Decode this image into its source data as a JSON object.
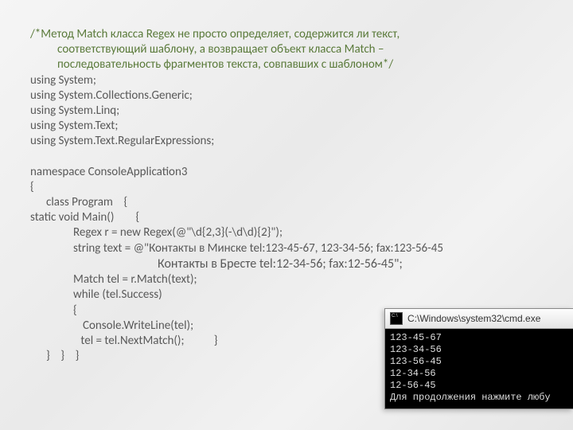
{
  "comment": {
    "line1": "/*Метод Match класса Regex не просто определяет, содержится ли текст,",
    "line2": "соответствующий шаблону, а возвращает объект класса Match –",
    "line3": "последовательность фрагментов текста, совпавших с шаблоном*/"
  },
  "code": {
    "l1": "using System;",
    "l2": "using System.Collections.Generic;",
    "l3": "using System.Linq;",
    "l4": "using System.Text;",
    "l5": "using System.Text.RegularExpressions;",
    "blank1": " ",
    "l6": "namespace ConsoleApplication3",
    "l7": "{",
    "l8": "class Program    {",
    "l9": "static void Main()        {",
    "l10": "Regex r = new Regex(@\"\\d{2,3}(-\\d\\d){2}\");",
    "l11": "string text = @\"Контакты в Минске tel:123-45-67, 123-34-56; fax:123-56-45",
    "l12": "Контакты в Бресте tel:12-34-56; fax:12-56-45\";",
    "l13": "Match tel = r.Match(text);",
    "l14": "while (tel.Success)",
    "l15": "{",
    "l16": "Console.WriteLine(tel);",
    "l17": " tel = tel.NextMatch();           }",
    "l18": "}    }    }"
  },
  "console": {
    "title": "C:\\Windows\\system32\\cmd.exe",
    "lines": [
      "123-45-67",
      "123-34-56",
      "123-56-45",
      "12-34-56",
      "12-56-45",
      "Для продолжения нажмите любу"
    ]
  }
}
